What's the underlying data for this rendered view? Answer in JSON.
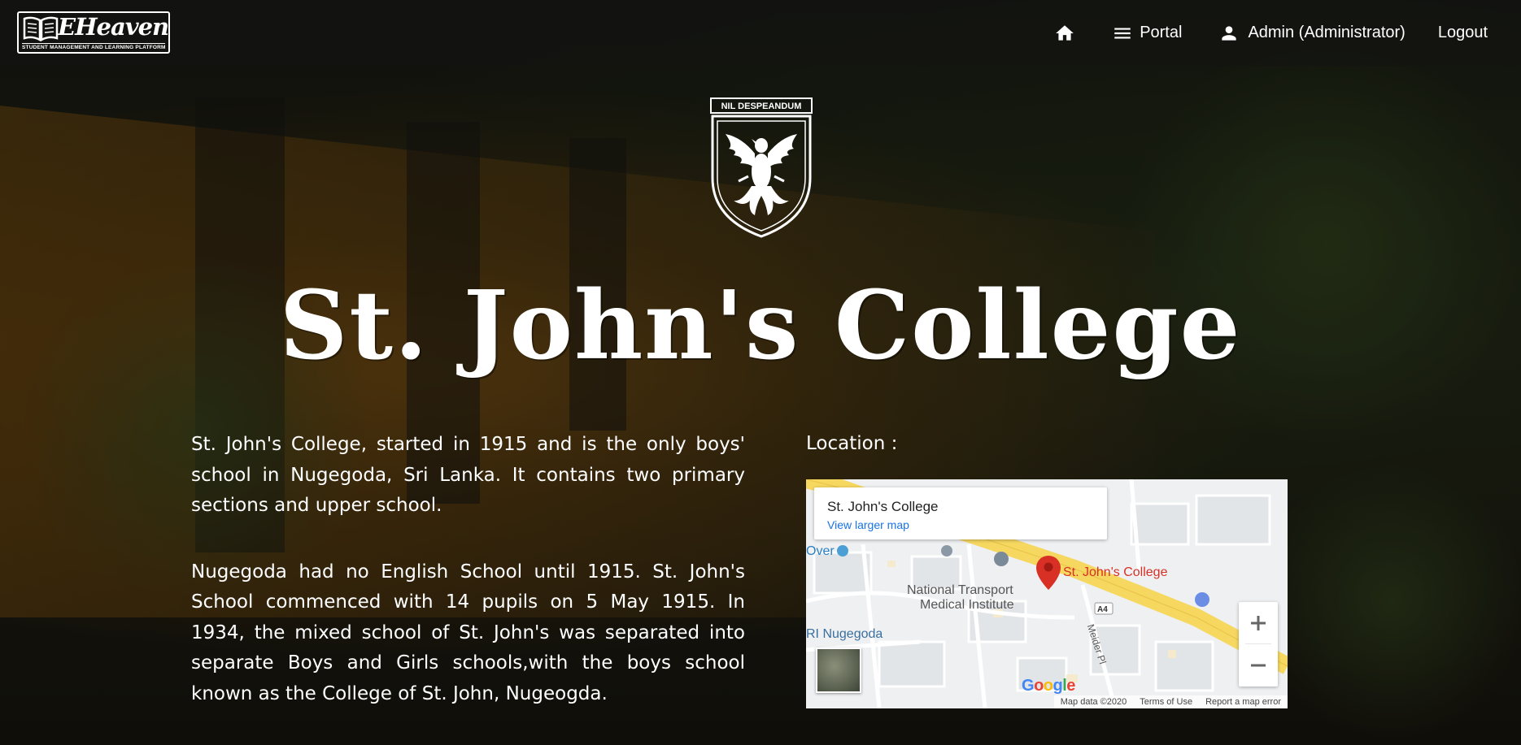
{
  "nav": {
    "brand_name": "EHeaven",
    "brand_tagline": "STUDENT MANAGEMENT AND LEARNING PLATFORM",
    "portal_label": "Portal",
    "user_label": "Admin (Administrator)",
    "logout_label": "Logout"
  },
  "hero": {
    "crest_motto": "NIL DESPEANDUM",
    "title": "St. John's College"
  },
  "about": {
    "paragraph_1": "St. John's College, started in 1915 and is the only boys' school in Nugegoda, Sri Lanka. It contains two primary sections and upper school.",
    "paragraph_2": "Nugegoda had no English School until 1915. St. John's School commenced with 14 pupils on 5 May 1915. In 1934, the mixed school of St. John's was separated into separate Boys and Girls schools,with the boys school known as the College of St. John, Nugeogda."
  },
  "location": {
    "label": "Location :",
    "map": {
      "card_title": "St. John's College",
      "card_link": "View larger map",
      "pin_label": "St. John's College",
      "labels": {
        "over": "Over",
        "institute_line1": "National Transport",
        "institute_line2": "Medical Institute",
        "nugegoda": "RI Nugegoda",
        "road_a4": "A4",
        "meider": "Meider Pl"
      },
      "zoom_in": "+",
      "zoom_out": "−",
      "google": "Google",
      "footer": {
        "map_data": "Map data ©2020",
        "terms": "Terms of Use",
        "report": "Report a map error"
      }
    }
  },
  "colors": {
    "link": "#1a73e8",
    "pin": "#d93025",
    "road_major": "#f6d860"
  }
}
